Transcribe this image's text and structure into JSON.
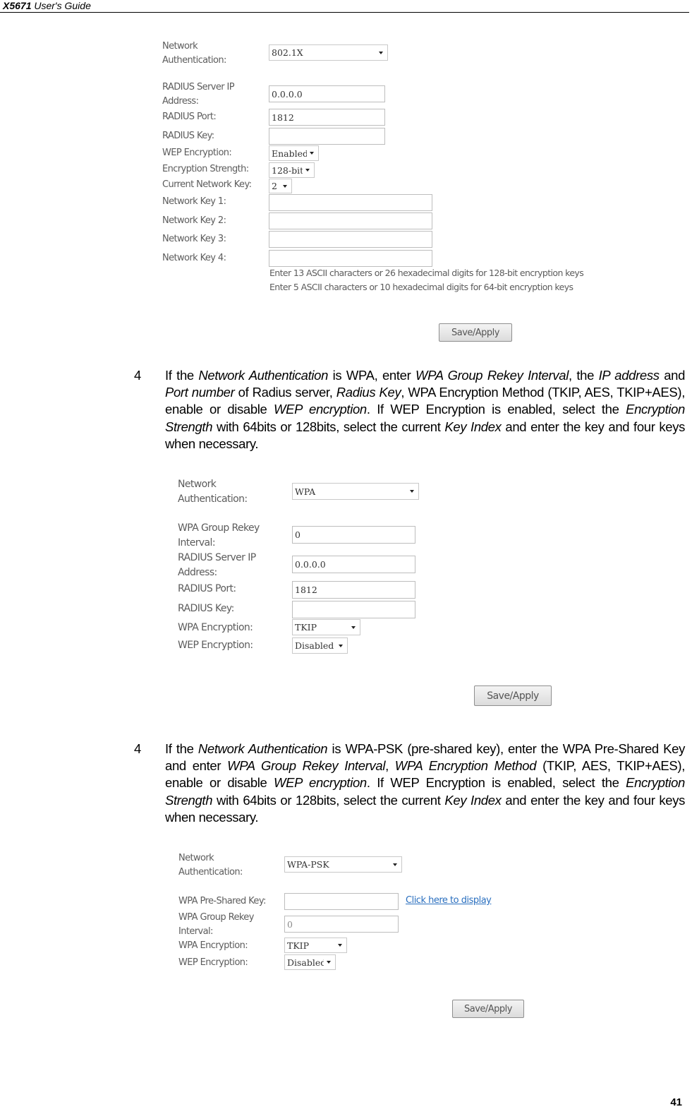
{
  "header": {
    "model": "X5671",
    "title": "User's Guide"
  },
  "page_number": "41",
  "screens": [
    {
      "id": "802-1x",
      "network_auth_label": "Network Authentication:",
      "network_auth_value": "802.1X",
      "fields": {
        "radius_ip_label": "RADIUS Server IP Address:",
        "radius_ip_value": "0.0.0.0",
        "radius_port_label": "RADIUS Port:",
        "radius_port_value": "1812",
        "radius_key_label": "RADIUS Key:",
        "radius_key_value": "",
        "wep_label": "WEP Encryption:",
        "wep_value": "Enabled",
        "strength_label": "Encryption Strength:",
        "strength_value": "128-bit",
        "current_key_label": "Current Network Key:",
        "current_key_value": "2",
        "key1_label": "Network Key 1:",
        "key2_label": "Network Key 2:",
        "key3_label": "Network Key 3:",
        "key4_label": "Network Key 4:",
        "hint1": "Enter 13 ASCII characters or 26 hexadecimal digits for 128-bit encryption keys",
        "hint2": "Enter 5 ASCII characters or 10 hexadecimal digits for 64-bit encryption keys"
      },
      "save_label": "Save/Apply"
    },
    {
      "id": "wpa",
      "network_auth_label": "Network Authentication:",
      "network_auth_value": "WPA",
      "fields": {
        "rekey_label": "WPA Group Rekey Interval:",
        "rekey_value": "0",
        "radius_ip_label": "RADIUS Server IP Address:",
        "radius_ip_value": "0.0.0.0",
        "radius_port_label": "RADIUS Port:",
        "radius_port_value": "1812",
        "radius_key_label": "RADIUS Key:",
        "radius_key_value": "",
        "wpa_enc_label": "WPA Encryption:",
        "wpa_enc_value": "TKIP",
        "wep_label": "WEP Encryption:",
        "wep_value": "Disabled"
      },
      "save_label": "Save/Apply"
    },
    {
      "id": "wpa-psk",
      "network_auth_label": "Network Authentication:",
      "network_auth_value": "WPA-PSK",
      "fields": {
        "psk_label": "WPA Pre-Shared Key:",
        "psk_value": "",
        "psk_link": "Click here to display",
        "rekey_label": "WPA Group Rekey Interval:",
        "rekey_value": "0",
        "wpa_enc_label": "WPA Encryption:",
        "wpa_enc_value": "TKIP",
        "wep_label": "WEP Encryption:",
        "wep_value": "Disabled"
      },
      "save_label": "Save/Apply"
    }
  ],
  "steps": [
    {
      "number": "4",
      "segments": [
        {
          "t": "If the "
        },
        {
          "t": "Network Authentication",
          "i": true
        },
        {
          "t": " is WPA, enter "
        },
        {
          "t": "WPA Group Rekey Interval",
          "i": true
        },
        {
          "t": ", the "
        },
        {
          "t": "IP address",
          "i": true
        },
        {
          "t": " and "
        },
        {
          "t": "Port number",
          "i": true
        },
        {
          "t": " of Radius server, "
        },
        {
          "t": "Radius Key",
          "i": true
        },
        {
          "t": ", WPA Encryption Method (TKIP, AES, TKIP+AES), enable or disable "
        },
        {
          "t": "WEP encryption",
          "i": true
        },
        {
          "t": ". If WEP Encryption is enabled, select the "
        },
        {
          "t": "Encryption Strength",
          "i": true
        },
        {
          "t": " with 64bits or 128bits, select the current "
        },
        {
          "t": "Key Index",
          "i": true
        },
        {
          "t": " and enter the key and four keys when necessary."
        }
      ]
    },
    {
      "number": "4",
      "segments": [
        {
          "t": "If the "
        },
        {
          "t": "Network Authentication",
          "i": true
        },
        {
          "t": " is WPA-PSK (pre-shared key), enter the WPA Pre-Shared Key and enter "
        },
        {
          "t": "WPA Group Rekey Interval",
          "i": true
        },
        {
          "t": ", "
        },
        {
          "t": "WPA Encryption Method",
          "i": true
        },
        {
          "t": " (TKIP, AES, TKIP+AES), enable or disable "
        },
        {
          "t": "WEP encryption",
          "i": true
        },
        {
          "t": ". If WEP Encryption is enabled, select the "
        },
        {
          "t": "Encryption Strength",
          "i": true
        },
        {
          "t": " with 64bits or 128bits, select the current "
        },
        {
          "t": "Key Index",
          "i": true
        },
        {
          "t": " and enter the key and four keys when necessary."
        }
      ]
    }
  ]
}
